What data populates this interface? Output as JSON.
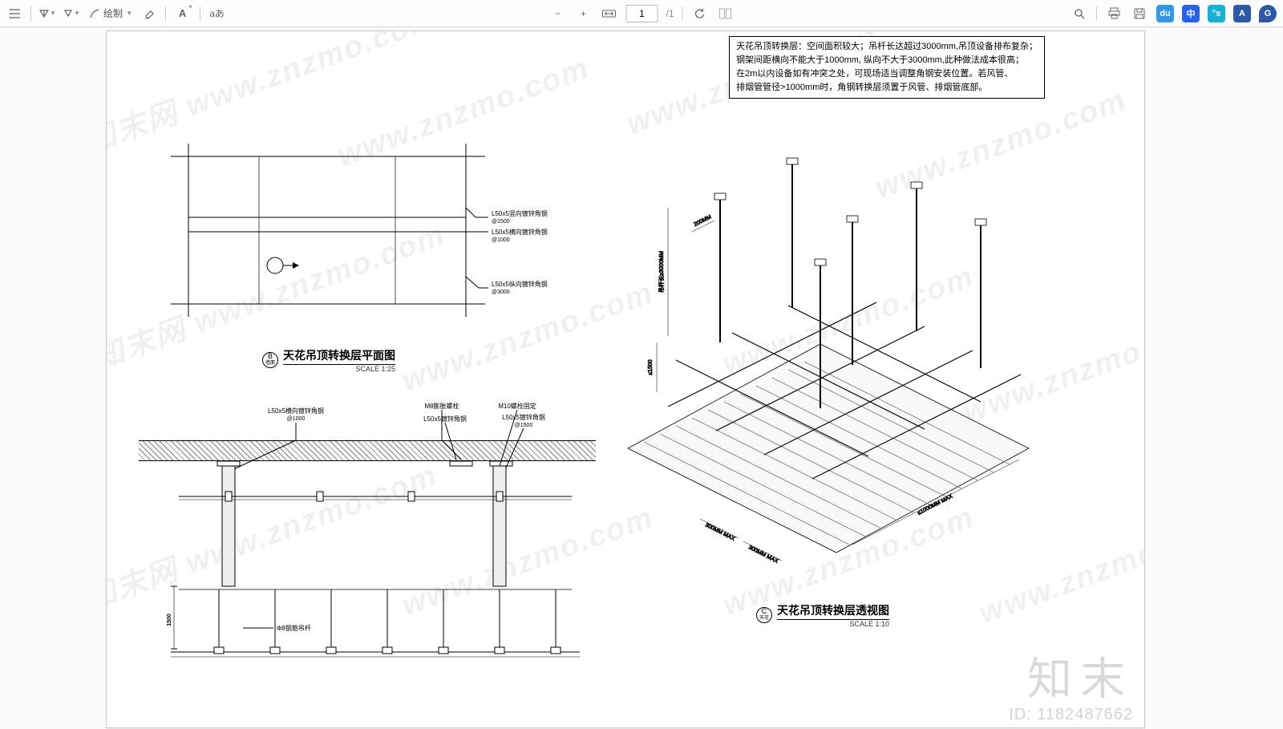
{
  "toolbar": {
    "draw_label": "绘制",
    "annot1": "A",
    "annot2": "aあ",
    "page_current": "1",
    "page_total": "/1"
  },
  "right_pills": {
    "p1": "du",
    "p2": "中",
    "p3": "°s",
    "p4": "A",
    "p5": "G"
  },
  "note": {
    "r1": "天花吊顶转换层：空间面积较大；吊杆长达超过3000mm,吊顶设备排布复杂；",
    "r2": "钢架间距横向不能大于1000mm, 纵向不大于3000mm,此种做法成本很高；",
    "r3": "在2m以内设备如有冲突之处，可现场适当调整角钢安装位置。若风管、",
    "r4": "排烟管管径>1000mm时，角钢转换层须置于风管、排烟管底部。"
  },
  "plan": {
    "tag": "B",
    "tag2": "墙面",
    "title": "天花吊顶转换层平面图",
    "scale": "SCALE  1:25",
    "lab1a": "L50x5竖向镀锌角钢",
    "lab1b": "@1500",
    "lab2a": "L50x5横向镀锌角钢",
    "lab2b": "@1000",
    "lab3a": "L50x5纵向镀锌角钢",
    "lab3b": "@3000"
  },
  "section": {
    "lab1a": "L50x5横向镀锌角钢",
    "lab1b": "@1000",
    "lab2a": "M8膨胀螺栓",
    "lab3a": "L50x5镀锌角钢",
    "lab4a": "M10螺栓固定",
    "lab5a": "L50x5镀锌角钢",
    "lab5b": "@1500",
    "hanger": "Φ8钢筋吊杆",
    "dim1500": "1500"
  },
  "iso": {
    "tag": "C",
    "tag2": "天花",
    "title": "天花吊顶转换层透视图",
    "scale": "SCALE  1:10",
    "dim300a": "300MM  MAX",
    "dim300b": "300MM  MAX",
    "dim1000": "≤1000MM  MAX",
    "dim200": "200MM",
    "dim3000": "吊杆长≥3000MM",
    "dim1500": "≤1500"
  },
  "wm": {
    "text": "www.znzmo.com",
    "zh": "知末网",
    "logo": "知末",
    "id": "ID: 1182487662"
  }
}
